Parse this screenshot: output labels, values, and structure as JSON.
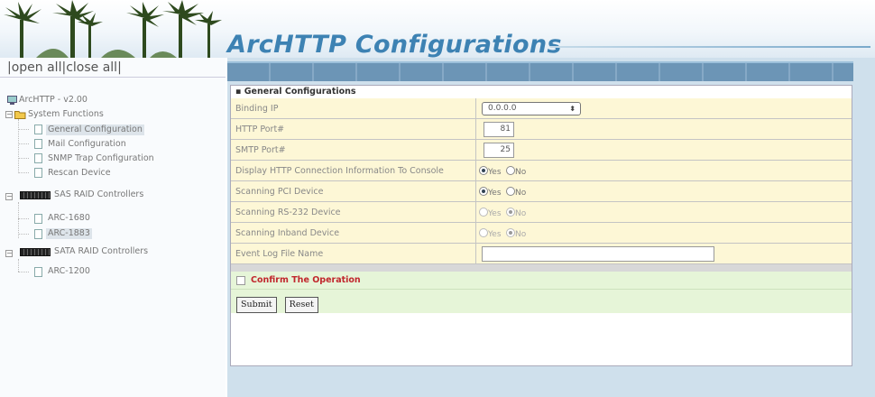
{
  "banner": {
    "title": "ArcHTTP Configurations"
  },
  "tree": {
    "open_all": "open all",
    "separator": "|",
    "close_all": "close all",
    "root": "ArcHTTP - v2.00",
    "system_functions": "System Functions",
    "items": [
      "General Configuration",
      "Mail Configuration",
      "SNMP Trap Configuration",
      "Rescan Device"
    ],
    "sas_group": "SAS RAID Controllers",
    "sas_items": [
      "ARC-1680",
      "ARC-1883"
    ],
    "sata_group": "SATA RAID Controllers",
    "sata_items": [
      "ARC-1200"
    ]
  },
  "form": {
    "section_title": "General Configurations",
    "binding_ip_label": "Binding IP",
    "binding_ip_value": "0.0.0.0",
    "http_port_label": "HTTP Port#",
    "http_port_value": "81",
    "smtp_port_label": "SMTP Port#",
    "smtp_port_value": "25",
    "display_http_label": "Display HTTP Connection Information To Console",
    "scan_pci_label": "Scanning PCI Device",
    "scan_rs232_label": "Scanning RS-232 Device",
    "scan_inband_label": "Scanning Inband Device",
    "event_log_label": "Event Log File Name",
    "event_log_value": "",
    "yes": "Yes",
    "no": "No"
  },
  "radios": {
    "display_http": "Yes",
    "scan_pci": "Yes",
    "scan_rs232": "No",
    "scan_inband": "No"
  },
  "confirm": {
    "label": "Confirm The Operation"
  },
  "buttons": {
    "submit": "Submit",
    "reset": "Reset"
  },
  "colors": {
    "title": "#3d82b3",
    "form_row": "#fdf7d6",
    "confirm_bg": "#e6f5d8",
    "confirm_text": "#c1272d",
    "main_bg": "#cfe0ec"
  }
}
